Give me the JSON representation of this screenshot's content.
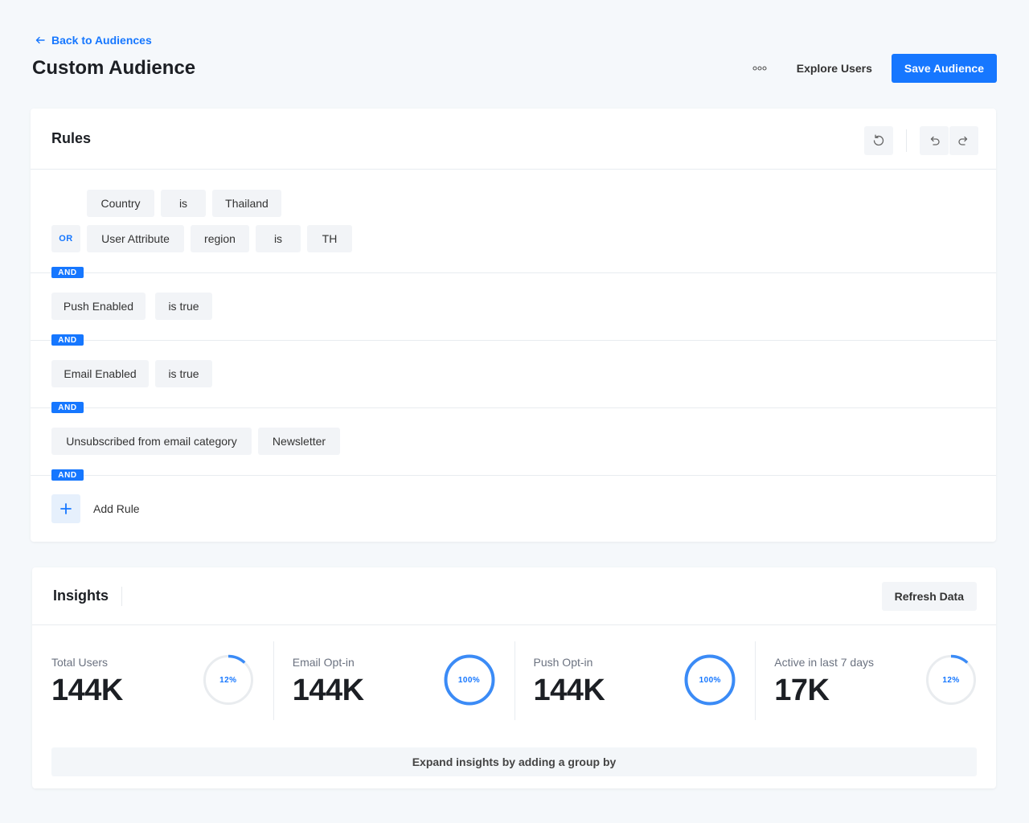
{
  "header": {
    "back_label": "Back to Audiences",
    "title": "Custom Audience",
    "explore_label": "Explore Users",
    "save_label": "Save Audience"
  },
  "rules": {
    "title": "Rules",
    "or_label": "OR",
    "and_label": "AND",
    "group1_row1": [
      "Country",
      "is",
      "Thailand"
    ],
    "group1_row2": [
      "User Attribute",
      "region",
      "is",
      "TH"
    ],
    "rule2": [
      "Push Enabled",
      "is true"
    ],
    "rule3": [
      "Email Enabled",
      "is true"
    ],
    "rule4": [
      "Unsubscribed from email category",
      "Newsletter"
    ],
    "add_rule_label": "Add Rule"
  },
  "insights": {
    "title": "Insights",
    "refresh_label": "Refresh Data",
    "metrics": [
      {
        "label": "Total Users",
        "value": "144K",
        "percent_text": "12%",
        "percent": 12
      },
      {
        "label": "Email Opt-in",
        "value": "144K",
        "percent_text": "100%",
        "percent": 100
      },
      {
        "label": "Push Opt-in",
        "value": "144K",
        "percent_text": "100%",
        "percent": 100
      },
      {
        "label": "Active in last 7 days",
        "value": "17K",
        "percent_text": "12%",
        "percent": 12
      }
    ],
    "expand_label": "Expand insights by adding a group by"
  },
  "colors": {
    "accent": "#1677ff",
    "ring_track": "#e9ecef",
    "ring_fill": "#3b8bf6"
  },
  "icons": [
    "back-arrow-icon",
    "more-dots-icon",
    "reset-icon",
    "undo-icon",
    "redo-icon",
    "plus-icon"
  ]
}
